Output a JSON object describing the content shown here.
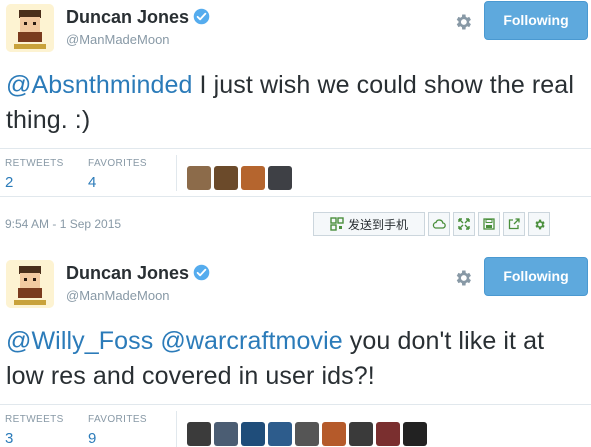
{
  "tweets": [
    {
      "name": "Duncan Jones",
      "handle": "@ManMadeMoon",
      "follow_label": "Following",
      "text_mention": "@Absnthminded",
      "text_body": " I just wish we could show the real thing. :)",
      "retweets_label": "RETWEETS",
      "retweets": "2",
      "favorites_label": "FAVORITES",
      "favorites": "4",
      "favoriters_colors": [
        "#8c6b4a",
        "#6b4a2a",
        "#b5652e",
        "#3e4045"
      ],
      "timestamp": "9:54 AM - 1 Sep 2015",
      "send_to_phone": "发送到手机"
    },
    {
      "name": "Duncan Jones",
      "handle": "@ManMadeMoon",
      "follow_label": "Following",
      "text_mention_1": "@Willy_Foss",
      "text_mention_2": "@warcraftmovie",
      "text_body": " you don't like it at low res and covered in user ids?!",
      "retweets_label": "RETWEETS",
      "retweets": "3",
      "favorites_label": "FAVORITES",
      "favorites": "9",
      "favoriters_colors": [
        "#3b3b3b",
        "#4b5d73",
        "#1f4d7a",
        "#2d5c8c",
        "#555555",
        "#b55a2a",
        "#3a3a3a",
        "#7a2f2f",
        "#222222"
      ]
    }
  ],
  "colors": {
    "link": "#2b7bb9",
    "follow_button": "#5ea9dd",
    "muted": "#8899a6",
    "verified": "#55acee"
  },
  "icons": [
    "verified-badge-icon",
    "gear-icon",
    "qr-icon",
    "cloud-icon",
    "expand-icon",
    "save-icon",
    "share-icon",
    "settings-icon"
  ]
}
